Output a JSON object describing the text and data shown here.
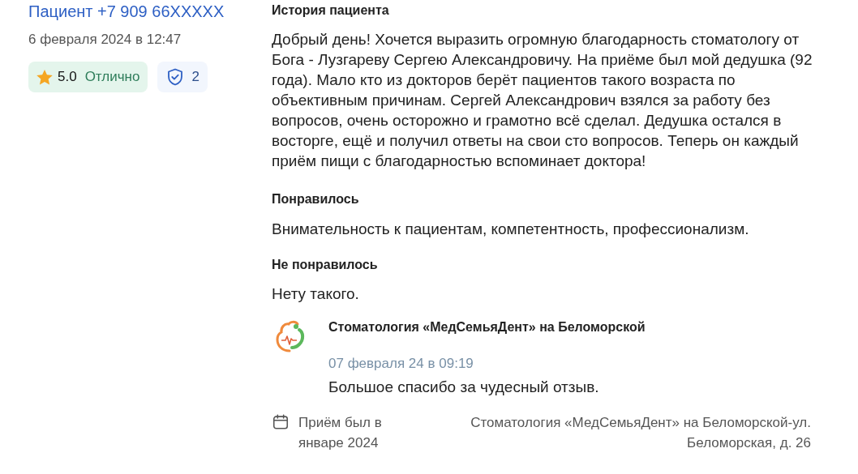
{
  "author": {
    "name": "Пациент +7 909 66XXXXX",
    "date": "6 февраля 2024 в 12:47"
  },
  "rating": {
    "score": "5.0",
    "label": "Отлично"
  },
  "verification": {
    "count": "2"
  },
  "review": {
    "section_title": "История пациента",
    "text": "Добрый день! Хочется выразить огромную благодарность стоматологу от Бога - Лузгареву Сергею Александровичу. На приёме был мой дедушка (92 года). Мало кто из докторов берёт пациентов такого возраста по объективным причинам. Сергей Александрович взялся за работу без вопросов, очень осторожно и грамотно всё сделал. Дедушка остался в восторге, ещё и получил ответы на свои сто вопросов. Теперь он каждый приём пищи с благодарностью вспоминает доктора!",
    "liked_title": "Понравилось",
    "liked": "Внимательность к пациентам, компетентность, профессионализм.",
    "disliked_title": "Не понравилось",
    "disliked": "Нету такого."
  },
  "clinic_reply": {
    "clinic": "Стоматология «МедСемьяДент» на Беломорской",
    "date": "07 февраля 24 в 09:19",
    "text": "Большое спасибо за чудесный отзыв."
  },
  "footer": {
    "visit": "Приём был в январе 2024",
    "location": "Стоматология «МедСемьяДент» на Беломорской-ул. Беломорская, д. 26"
  }
}
